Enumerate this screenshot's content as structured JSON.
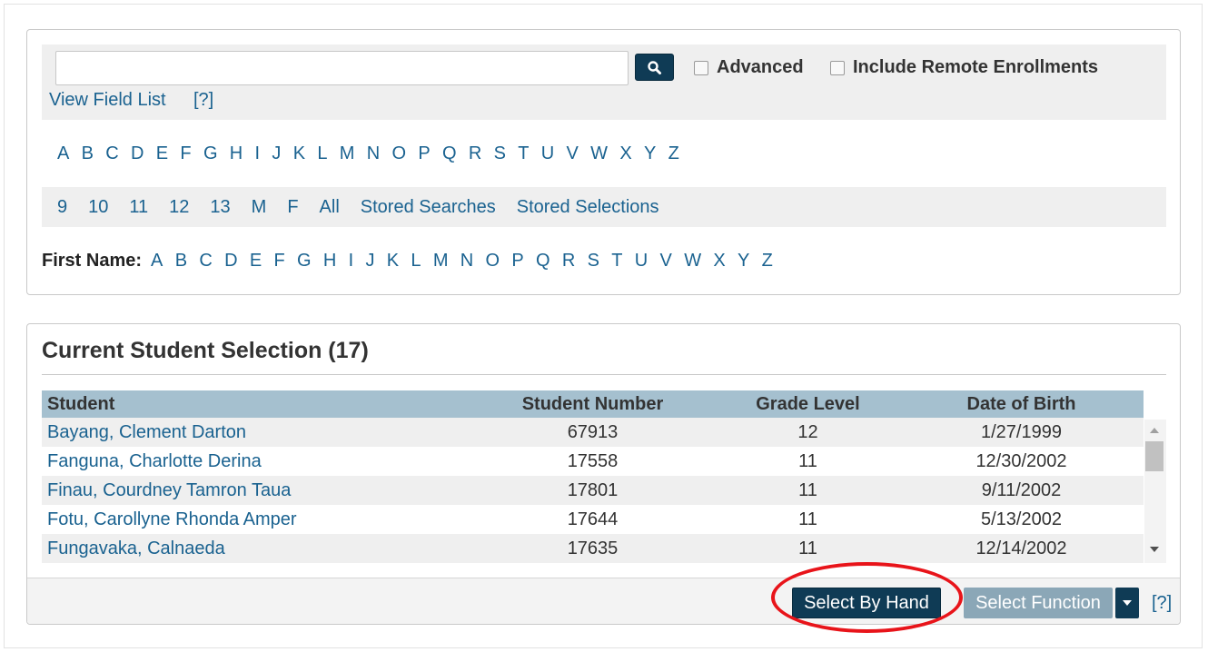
{
  "search": {
    "input_value": "",
    "advanced_label": "Advanced",
    "remote_label": "Include Remote Enrollments",
    "view_field_list": "View Field List",
    "help": "[?]"
  },
  "last_name_letters": [
    "A",
    "B",
    "C",
    "D",
    "E",
    "F",
    "G",
    "H",
    "I",
    "J",
    "K",
    "L",
    "M",
    "N",
    "O",
    "P",
    "Q",
    "R",
    "S",
    "T",
    "U",
    "V",
    "W",
    "X",
    "Y",
    "Z"
  ],
  "quick_filters": [
    "9",
    "10",
    "11",
    "12",
    "13",
    "M",
    "F",
    "All",
    "Stored Searches",
    "Stored Selections"
  ],
  "first_name": {
    "label": "First Name",
    "letters": [
      "A",
      "B",
      "C",
      "D",
      "E",
      "F",
      "G",
      "H",
      "I",
      "J",
      "K",
      "L",
      "M",
      "N",
      "O",
      "P",
      "Q",
      "R",
      "S",
      "T",
      "U",
      "V",
      "W",
      "X",
      "Y",
      "Z"
    ]
  },
  "selection": {
    "title": "Current Student Selection (17)",
    "columns": [
      "Student",
      "Student Number",
      "Grade Level",
      "Date of Birth"
    ],
    "rows": [
      {
        "student": "Bayang, Clement Darton",
        "number": "67913",
        "grade": "12",
        "dob": "1/27/1999"
      },
      {
        "student": "Fanguna, Charlotte Derina",
        "number": "17558",
        "grade": "11",
        "dob": "12/30/2002"
      },
      {
        "student": "Finau, Courdney Tamron Taua",
        "number": "17801",
        "grade": "11",
        "dob": "9/11/2002"
      },
      {
        "student": "Fotu, Carollyne Rhonda Amper",
        "number": "17644",
        "grade": "11",
        "dob": "5/13/2002"
      },
      {
        "student": "Fungavaka, Calnaeda",
        "number": "17635",
        "grade": "11",
        "dob": "12/14/2002"
      }
    ]
  },
  "footer": {
    "select_by_hand": "Select By Hand",
    "select_function": "Select Function",
    "help": "[?]"
  },
  "colors": {
    "primary_button": "#0f3b55",
    "disabled_button": "#8ba7b7",
    "link": "#1a6290",
    "table_header": "#a5c0cf",
    "highlight": "#e8141a"
  }
}
